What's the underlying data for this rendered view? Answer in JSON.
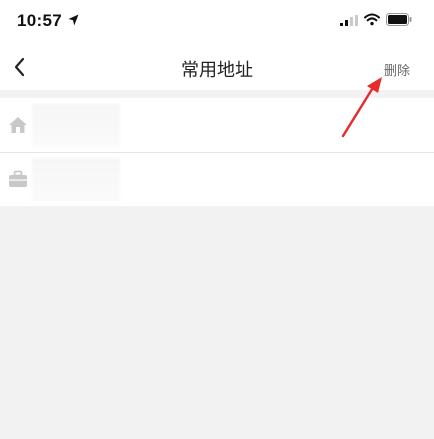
{
  "status_bar": {
    "time": "10:57",
    "icons": [
      "location-arrow-icon",
      "signal-icon",
      "wifi-icon",
      "battery-icon"
    ]
  },
  "nav": {
    "back_icon": "chevron-left-icon",
    "title": "常用地址",
    "delete_label": "删除"
  },
  "addresses": [
    {
      "icon": "home-icon"
    },
    {
      "icon": "briefcase-icon"
    }
  ],
  "colors": {
    "background": "#f2f2f2",
    "surface": "#ffffff",
    "icon_gray": "#c8c8c8",
    "annotation_red": "#e82a2a"
  }
}
